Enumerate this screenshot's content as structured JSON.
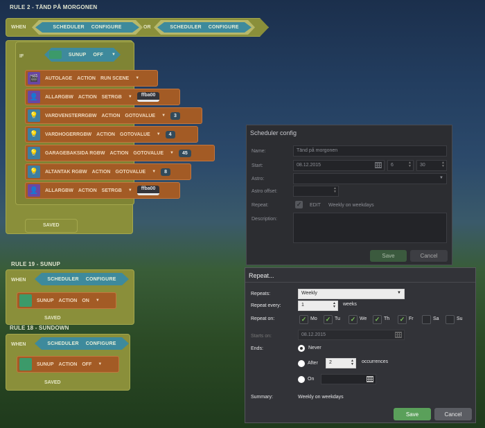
{
  "rules": {
    "rule2": {
      "title": "RULE 2 - TÄND PÅ MORGONEN",
      "when": "WHEN",
      "trigger1": {
        "a": "SCHEDULER",
        "b": "CONFIGURE"
      },
      "or": "OR",
      "trigger2": {
        "a": "SCHEDULER",
        "b": "CONFIGURE"
      },
      "if": "IF",
      "condition": {
        "device": "SUNUP",
        "value": "OFF"
      },
      "actions": [
        {
          "device": "AUTOLAGE",
          "verb": "ACTION",
          "cmd": "RUN SCENE",
          "value": ""
        },
        {
          "device": "ALLARGBW",
          "verb": "ACTION",
          "cmd": "SETRGB",
          "value": "ffba00"
        },
        {
          "device": "VARDVENSTERRGBW",
          "verb": "ACTION",
          "cmd": "GOTOVALUE",
          "value": "3"
        },
        {
          "device": "VARDHOGERRGBW",
          "verb": "ACTION",
          "cmd": "GOTOVALUE",
          "value": "4"
        },
        {
          "device": "GARAGEBAKSIDA RGBW",
          "verb": "ACTION",
          "cmd": "GOTOVALUE",
          "value": "45"
        },
        {
          "device": "ALTANTAK RGBW",
          "verb": "ACTION",
          "cmd": "GOTOVALUE",
          "value": "8"
        },
        {
          "device": "ALLARGBW",
          "verb": "ACTION",
          "cmd": "SETRGB",
          "value": "ffba00"
        }
      ],
      "saved": "SAVED"
    },
    "rule19": {
      "title": "RULE 19 - SUNUP",
      "when": "WHEN",
      "trigger": {
        "a": "SCHEDULER",
        "b": "CONFIGURE"
      },
      "action": {
        "device": "SUNUP",
        "verb": "ACTION",
        "value": "ON"
      },
      "saved": "SAVED"
    },
    "rule18": {
      "title": "RULE 18 - SUNDOWN",
      "when": "WHEN",
      "trigger": {
        "a": "SCHEDULER",
        "b": "CONFIGURE"
      },
      "action": {
        "device": "SUNUP",
        "verb": "ACTION",
        "value": "OFF"
      },
      "saved": "SAVED"
    }
  },
  "scheduler": {
    "title": "Scheduler config",
    "name_label": "Name:",
    "name_value": "Tänd på morgonen",
    "start_label": "Start:",
    "start_date": "08.12.2015",
    "start_hour": "6",
    "start_minute": "30",
    "astro_label": "Astro:",
    "astro_offset_label": "Astro offset:",
    "repeat_label": "Repeat:",
    "repeat_edit": "EDIT",
    "repeat_summary": "Weekly on weekdays",
    "description_label": "Description:",
    "save": "Save",
    "cancel": "Cancel"
  },
  "repeat": {
    "title": "Repeat...",
    "repeats_label": "Repeats:",
    "repeats_value": "Weekly",
    "every_label": "Repeat every:",
    "every_value": "1",
    "every_unit": "weeks",
    "on_label": "Repeat on:",
    "days": [
      {
        "label": "Mo",
        "checked": true
      },
      {
        "label": "Tu",
        "checked": true
      },
      {
        "label": "We",
        "checked": true
      },
      {
        "label": "Th",
        "checked": true
      },
      {
        "label": "Fr",
        "checked": true
      },
      {
        "label": "Sa",
        "checked": false
      },
      {
        "label": "Su",
        "checked": false
      }
    ],
    "starts_label": "Starts on:",
    "starts_value": "08.12.2015",
    "ends_label": "Ends:",
    "never_label": "Never",
    "after_label": "After",
    "after_value": "2",
    "occurrences": "occurrences",
    "on_label_end": "On",
    "summary_label": "Summary:",
    "summary_value": "Weekly on weekdays",
    "save": "Save",
    "cancel": "Cancel"
  },
  "colors": {
    "accent_green": "#5aa05a",
    "block_orange": "#a35b25",
    "block_yellow": "#8a8f3a",
    "block_blue": "#3e8a9c"
  }
}
